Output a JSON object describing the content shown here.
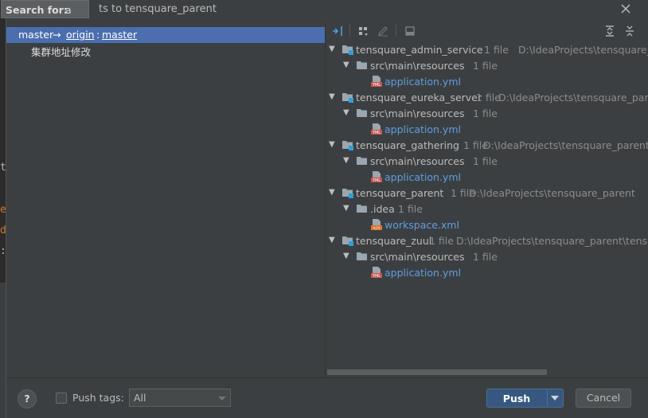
{
  "editor_edge": {
    "chars": [
      "t",
      "e",
      "d",
      ":"
    ],
    "colors": [
      "#bbbbbb",
      "#cc7832",
      "#cc7832",
      "#bbbbbb"
    ]
  },
  "search_popup": {
    "label": "Search for:",
    "value": "a"
  },
  "title": "ts to tensquare_parent",
  "commit_header": {
    "branch": "master",
    "arrow": "→",
    "remote": "origin",
    "sep": ":",
    "remote_branch": "master"
  },
  "commit_message": "集群地址修改",
  "tree": [
    {
      "label": "tensquare_admin_service",
      "count": "1 file",
      "path": "D:\\IdeaProjects\\tensquare_parent\\tensquare_admin_service",
      "folder": "src\\main\\resources",
      "folder_count": "1 file",
      "file": "application.yml",
      "file_type": "YML"
    },
    {
      "label": "tensquare_eureka_server",
      "count": "1 file",
      "path": "D:\\IdeaProjects\\tensquare_parent\\tensquare_eureka_server",
      "folder": "src\\main\\resources",
      "folder_count": "1 file",
      "file": "application.yml",
      "file_type": "YML"
    },
    {
      "label": "tensquare_gathering",
      "count": "1 file",
      "path": "D:\\IdeaProjects\\tensquare_parent\\tensquare_gathering",
      "folder": "src\\main\\resources",
      "folder_count": "1 file",
      "file": "application.yml",
      "file_type": "YML"
    },
    {
      "label": "tensquare_parent",
      "count": "1 file",
      "path": "D:\\IdeaProjects\\tensquare_parent",
      "folder": ".idea",
      "folder_count": "1 file",
      "file": "workspace.xml",
      "file_type": "XML"
    },
    {
      "label": "tensquare_zuul",
      "count": "1 file",
      "path": "D:\\IdeaProjects\\tensquare_parent\\tensquare_zuul",
      "folder": "src\\main\\resources",
      "folder_count": "1 file",
      "file": "application.yml",
      "file_type": "YML"
    }
  ],
  "footer": {
    "help": "?",
    "push_tags_label": "Push tags:",
    "tags_option": "All",
    "push_label": "Push",
    "cancel_label": "Cancel"
  },
  "colors": {
    "selection": "#4b6eaf",
    "primary_button": "#365880",
    "file_link": "#5e9fe2"
  },
  "icons": [
    "close-icon",
    "collapse-arrows-icon",
    "group-by-icon",
    "edit-icon",
    "commit-details-icon",
    "expand-all-icon",
    "collapse-all-icon",
    "module-folder-icon",
    "folder-icon",
    "yml-file-icon",
    "xml-file-icon"
  ]
}
